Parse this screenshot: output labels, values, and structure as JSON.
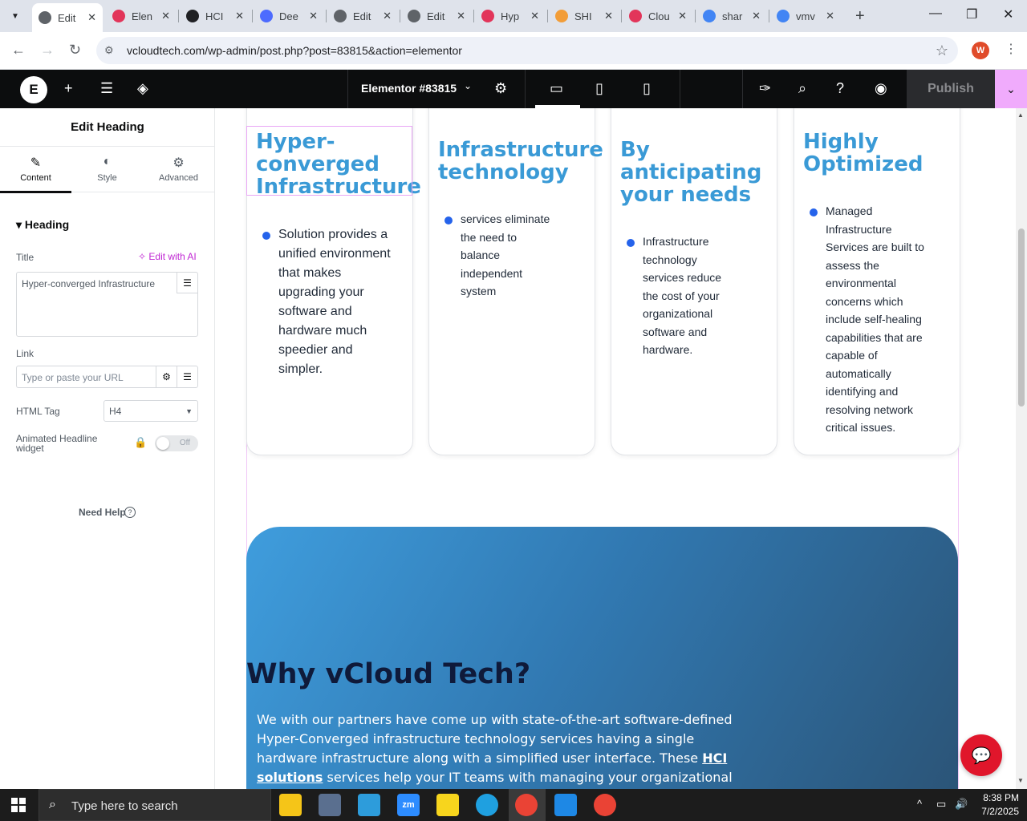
{
  "browser": {
    "tabs": [
      {
        "title": "Edit",
        "color": "#5f6368",
        "active": true
      },
      {
        "title": "Elen",
        "color": "#e2355a"
      },
      {
        "title": "HCI",
        "color": "#202124"
      },
      {
        "title": "Dee",
        "color": "#4d6bfe"
      },
      {
        "title": "Edit",
        "color": "#5f6368"
      },
      {
        "title": "Edit",
        "color": "#5f6368"
      },
      {
        "title": "Hyp",
        "color": "#e2355a"
      },
      {
        "title": "SHI",
        "color": "#f29d38"
      },
      {
        "title": "Clou",
        "color": "#e2355a"
      },
      {
        "title": "shar",
        "color": "#4285f4"
      },
      {
        "title": "vmv",
        "color": "#4285f4"
      }
    ],
    "url": "vcloudtech.com/wp-admin/post.php?post=83815&action=elementor",
    "profile_initial": "W"
  },
  "editor": {
    "document_title": "Elementor #83815",
    "publish_label": "Publish",
    "logo_label": "E"
  },
  "panel": {
    "title": "Edit Heading",
    "tabs": [
      {
        "label": "Content",
        "icon": "pencil-icon"
      },
      {
        "label": "Style",
        "icon": "half-circle-icon"
      },
      {
        "label": "Advanced",
        "icon": "gear-icon"
      }
    ],
    "section": "Heading",
    "title_label": "Title",
    "edit_with_ai": "Edit with AI",
    "title_value": "Hyper-converged Infrastructure",
    "link_label": "Link",
    "link_placeholder": "Type or paste your URL",
    "html_tag_label": "HTML Tag",
    "html_tag_value": "H4",
    "animated_label": "Animated Headline widget",
    "animated_toggle": "Off",
    "need_help": "Need Help"
  },
  "canvas": {
    "cards": [
      {
        "title": "Hyper-\nconverged\nInfrastructure",
        "text": "Solution provides a\nunified environment\nthat makes\nupgrading your\nsoftware and\nhardware much\nspeedier and\nsimpler."
      },
      {
        "title": "Infrastructure\ntechnology",
        "text": "services eliminate\nthe need to\nbalance\nindependent\nsystem"
      },
      {
        "title": "By\nanticipating\nyour needs",
        "text": "Infrastructure\ntechnology\nservices reduce\nthe cost of your\norganizational\nsoftware and\nhardware."
      },
      {
        "title": "Highly\nOptimized",
        "text": "Managed\nInfrastructure\nServices are built to\nassess the\nenvironmental\nconcerns which\ninclude self-healing\ncapabilities that are\ncapable of\nautomatically\nidentifying and\nresolving network\ncritical issues."
      }
    ],
    "why_title": "Why vCloud Tech?",
    "why_text_before": "We with our partners have come up with state-of-the-art software-defined Hyper-Converged infrastructure technology services having a single hardware infrastructure along with a simplified user interface. These ",
    "why_text_link": "HCI solutions",
    "why_text_after": " services help your IT teams with managing your organizational"
  },
  "taskbar": {
    "search_placeholder": "Type here to search",
    "time": "8:38 PM",
    "date": "7/2/2025",
    "apps": [
      {
        "name": "file-explorer",
        "color": "#f5c518",
        "label": ""
      },
      {
        "name": "app-bird",
        "color": "#5a6f8f",
        "label": ""
      },
      {
        "name": "app-diamond",
        "color": "#2d9cdb",
        "label": ""
      },
      {
        "name": "zoom",
        "color": "#2d8cff",
        "label": "zm"
      },
      {
        "name": "sticky-notes",
        "color": "#f7d51d",
        "label": ""
      },
      {
        "name": "edge",
        "color": "#1fa0e0",
        "label": ""
      },
      {
        "name": "chrome",
        "color": "#ea4335",
        "label": ""
      },
      {
        "name": "vscode",
        "color": "#1e88e5",
        "label": ""
      },
      {
        "name": "chrome-2",
        "color": "#ea4335",
        "label": ""
      }
    ]
  }
}
